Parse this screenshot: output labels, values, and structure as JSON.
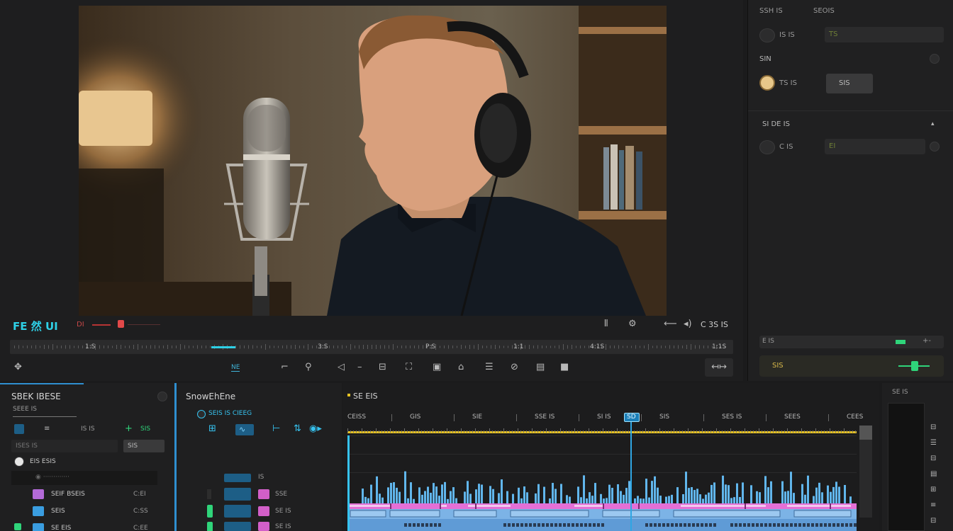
{
  "viewer": {
    "timecode_label": "FE 然 UI",
    "timecode_secondary": "DI",
    "zoom_text": "C 3S IS",
    "playhead_label": "UE",
    "ruler_labels": [
      "1:S",
      "3:S",
      "P:S",
      "1:1",
      "4:1S",
      "1:1S"
    ],
    "transport_center_label": "NE"
  },
  "inspector": {
    "header_left": "SSH IS",
    "header_right": "SEOIS",
    "row1_label": "IS IS",
    "row1_field": "TS",
    "section1_title": "SIN",
    "row2_label": "TS IS",
    "row2_button": "SIS",
    "section2_title": "SI DE IS",
    "row3_label": "C IS",
    "row3_field": "EI",
    "footer_left": "E IS",
    "footer_bar_label": "SIS",
    "accent_green": "#2fd47a",
    "accent_yellow": "#d9b94a"
  },
  "media": {
    "title": "SBEK IBESE",
    "subtitle": "SEEE IS",
    "tool_labels": [
      "IS IS",
      "SIS"
    ],
    "search_placeholder": "ISES IS",
    "search_button": "SIS",
    "folder_label": "EIS ESIS",
    "items": [
      {
        "name": "SEIF BSEIS",
        "meta": "C:EI"
      },
      {
        "name": "SEIS",
        "meta": "C:SS"
      },
      {
        "name": "SE EIS",
        "meta": "C:EE"
      }
    ]
  },
  "effects": {
    "title": "SnowEhEne",
    "subtitle": "SEIS IS  CIEEG",
    "row_labels": [
      "IS",
      "SE IS",
      "SE IS"
    ],
    "row_value": "SSE"
  },
  "timeline": {
    "title": "SE EIS",
    "playhead_label": "SD",
    "ruler_labels": [
      "CEISS",
      "GIS",
      "SIE",
      "SSE IS",
      "SI IS",
      "SIS",
      "SES IS",
      "SEES",
      "CEES"
    ],
    "waveform_color": "#61b6ec",
    "clip_pink": "#e46fd6",
    "clip_blue": "#7cb3e6",
    "ruler_yellow": "#e6c224"
  },
  "right_tools": {
    "title": "SE IS"
  }
}
